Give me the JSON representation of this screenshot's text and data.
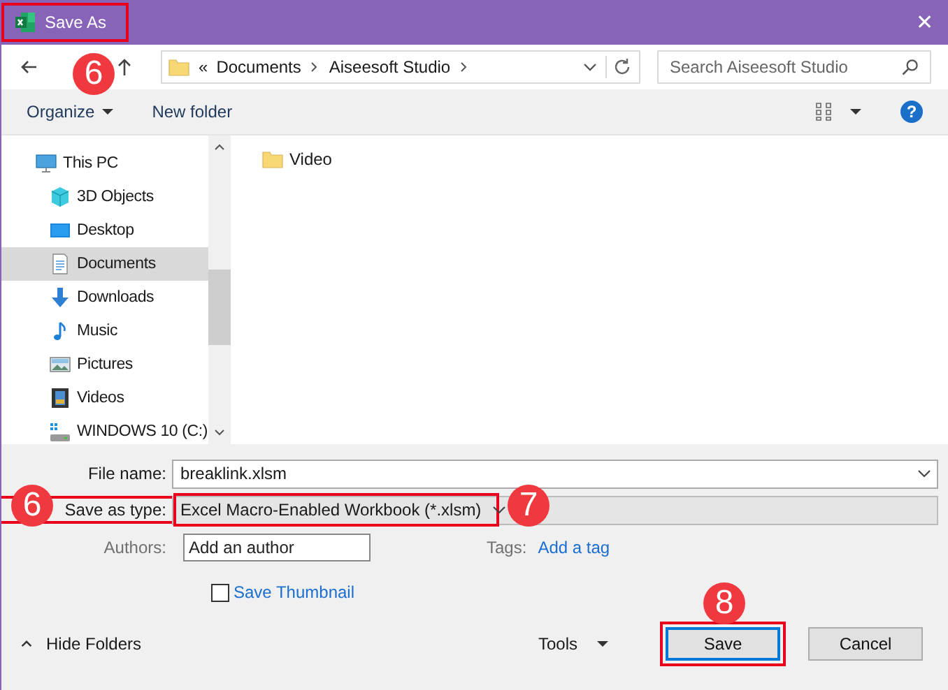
{
  "window": {
    "title": "Save As",
    "highlighted": true,
    "close": "✕"
  },
  "nav": {
    "overflow": "«",
    "path": [
      "Documents",
      "Aiseesoft Studio"
    ],
    "search": {
      "placeholder": "Search Aiseesoft Studio"
    }
  },
  "toolbar": {
    "organize": "Organize",
    "new_folder": "New folder",
    "help": "?"
  },
  "sidebar": {
    "items": [
      {
        "label": "This PC",
        "kind": "pc",
        "selected": false,
        "children": [
          {
            "label": "3D Objects",
            "kind": "cube",
            "selected": false
          },
          {
            "label": "Desktop",
            "kind": "desktop",
            "selected": false
          },
          {
            "label": "Documents",
            "kind": "document",
            "selected": true
          },
          {
            "label": "Downloads",
            "kind": "download",
            "selected": false
          },
          {
            "label": "Music",
            "kind": "music",
            "selected": false
          },
          {
            "label": "Pictures",
            "kind": "pictures",
            "selected": false
          },
          {
            "label": "Videos",
            "kind": "videos",
            "selected": false
          },
          {
            "label": "WINDOWS 10 (C:)",
            "kind": "drive",
            "selected": false
          }
        ]
      }
    ]
  },
  "files": [
    {
      "name": "Video",
      "kind": "folder"
    }
  ],
  "form": {
    "file_name": {
      "label": "File name:",
      "value": "breaklink.xlsm"
    },
    "save_as_type": {
      "label": "Save as type:",
      "value": "Excel Macro-Enabled Workbook (*.xlsm)",
      "label_highlighted": true,
      "value_highlighted": true
    },
    "authors": {
      "label": "Authors:",
      "placeholder": "Add an author"
    },
    "tags": {
      "label": "Tags:",
      "value": "Add a tag"
    },
    "save_thumbnail": {
      "label": "Save Thumbnail",
      "checked": false
    }
  },
  "footer": {
    "hide_folders": "Hide Folders",
    "tools": "Tools",
    "buttons": [
      {
        "label": "Save",
        "kind": "primary",
        "highlighted": true
      },
      {
        "label": "Cancel",
        "kind": "secondary",
        "highlighted": false
      }
    ]
  },
  "markers": [
    {
      "number": "6"
    },
    {
      "number": "6"
    },
    {
      "number": "7"
    },
    {
      "number": "8"
    }
  ]
}
